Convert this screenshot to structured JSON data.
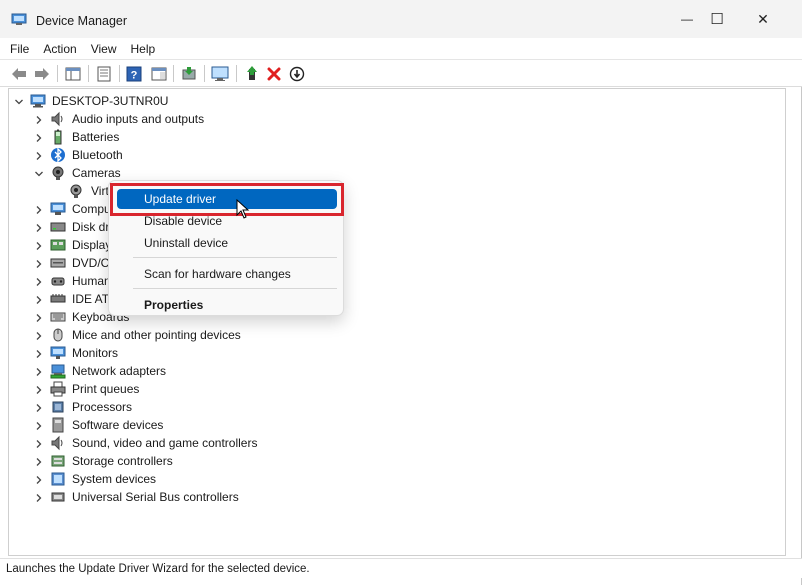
{
  "window": {
    "title": "Device Manager",
    "minimize_glyph": "—",
    "maximize_glyph": "☐",
    "close_glyph": "✕"
  },
  "menu": [
    "File",
    "Action",
    "View",
    "Help"
  ],
  "tree": {
    "root": "DESKTOP-3UTNR0U",
    "categories": [
      {
        "label": "Audio inputs and outputs",
        "icon": "speaker-icon",
        "expanded": false
      },
      {
        "label": "Batteries",
        "icon": "battery-icon",
        "expanded": false
      },
      {
        "label": "Bluetooth",
        "icon": "bluetooth-icon",
        "expanded": false
      },
      {
        "label": "Cameras",
        "icon": "camera-icon",
        "expanded": true
      },
      {
        "label": "Virt",
        "icon": "webcam-icon",
        "child": true,
        "selected": true
      },
      {
        "label": "Compu",
        "icon": "computer-icon",
        "expanded": false
      },
      {
        "label": "Disk dr",
        "icon": "disk-icon",
        "expanded": false
      },
      {
        "label": "Display",
        "icon": "display-adapter-icon",
        "expanded": false
      },
      {
        "label": "DVD/C",
        "icon": "dvd-icon",
        "expanded": false
      },
      {
        "label": "Human",
        "icon": "hid-icon",
        "expanded": false
      },
      {
        "label": "IDE ATA",
        "icon": "ide-icon",
        "expanded": false
      },
      {
        "label": "Keyboards",
        "icon": "keyboard-icon",
        "expanded": false
      },
      {
        "label": "Mice and other pointing devices",
        "icon": "mouse-icon",
        "expanded": false
      },
      {
        "label": "Monitors",
        "icon": "monitor-icon",
        "expanded": false
      },
      {
        "label": "Network adapters",
        "icon": "network-icon",
        "expanded": false
      },
      {
        "label": "Print queues",
        "icon": "printer-icon",
        "expanded": false
      },
      {
        "label": "Processors",
        "icon": "processor-icon",
        "expanded": false
      },
      {
        "label": "Software devices",
        "icon": "software-device-icon",
        "expanded": false
      },
      {
        "label": "Sound, video and game controllers",
        "icon": "speaker-icon",
        "expanded": false
      },
      {
        "label": "Storage controllers",
        "icon": "storage-icon",
        "expanded": false
      },
      {
        "label": "System devices",
        "icon": "system-device-icon",
        "expanded": false
      },
      {
        "label": "Universal Serial Bus controllers",
        "icon": "usb-icon",
        "expanded": false
      }
    ]
  },
  "context_menu": {
    "items": [
      {
        "label": "Update driver",
        "active": true
      },
      {
        "label": "Disable device"
      },
      {
        "label": "Uninstall device"
      },
      {
        "label": "Scan for hardware changes"
      },
      {
        "label": "Properties",
        "bold": true
      }
    ]
  },
  "status": "Launches the Update Driver Wizard for the selected device.",
  "colors": {
    "accent": "#0067c0",
    "highlight_box": "#d9262e",
    "delete_red": "#e02020",
    "enable_green": "#2e9c3a"
  }
}
